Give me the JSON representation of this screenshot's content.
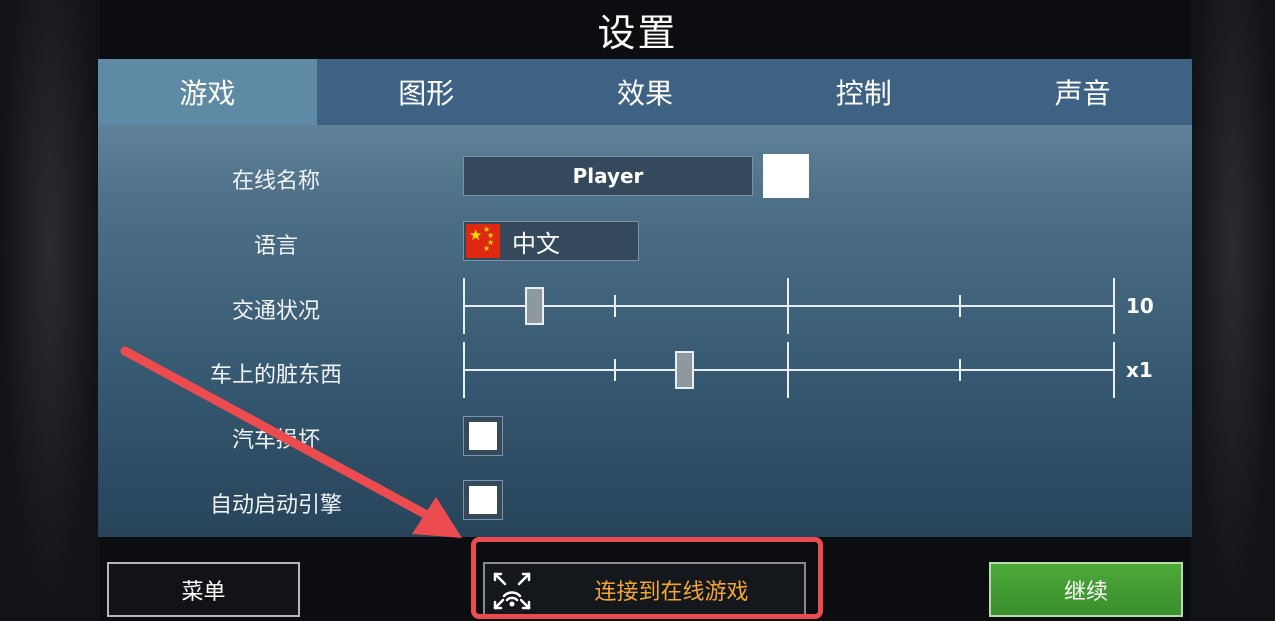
{
  "title": "设置",
  "tabs": [
    {
      "label": "游戏",
      "active": true
    },
    {
      "label": "图形",
      "active": false
    },
    {
      "label": "效果",
      "active": false
    },
    {
      "label": "控制",
      "active": false
    },
    {
      "label": "声音",
      "active": false
    }
  ],
  "settings": {
    "online_name": {
      "label": "在线名称",
      "value": "Player"
    },
    "language": {
      "label": "语言",
      "value": "中文",
      "flag_icon": "china-flag-icon"
    },
    "traffic": {
      "label": "交通状况",
      "value": "10",
      "level": 0.11
    },
    "dirt": {
      "label": "车上的脏东西",
      "value": "x1",
      "level": 0.34
    },
    "car_damage": {
      "label": "汽车损坏",
      "checked": false
    },
    "auto_start": {
      "label": "自动启动引擎",
      "checked": false
    }
  },
  "buttons": {
    "menu": "菜单",
    "connect_online": "连接到在线游戏",
    "continue": "继续"
  },
  "colors": {
    "accent_highlight": "#ec4b4f",
    "online_text": "#f2a633",
    "continue_green": "#4ca93a",
    "tab_active": "#5e8aa5",
    "tab_bar": "#3e6283"
  }
}
